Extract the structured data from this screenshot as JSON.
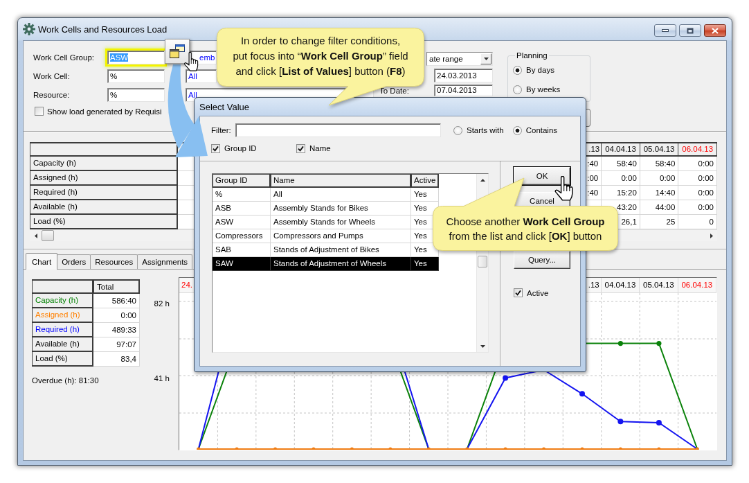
{
  "window": {
    "title": "Work Cells and Resources Load"
  },
  "filters": {
    "fields": [
      {
        "label": "Work Cell Group:",
        "value": "ASW",
        "focused": true,
        "description": "emb"
      },
      {
        "label": "Work Cell:",
        "value": "%",
        "focused": false,
        "description": "All"
      },
      {
        "label": "Resource:",
        "value": "%",
        "focused": false,
        "description": "All"
      }
    ],
    "show_requisitions": {
      "label": "Show load generated by Requisi",
      "checked": false
    },
    "period": {
      "value": "ate range"
    },
    "from_date": {
      "value": "24.03.2013"
    },
    "to_date": {
      "label": "To Date:",
      "value": "07.04.2013"
    },
    "planning": {
      "title": "Planning",
      "options": [
        {
          "label": "By days",
          "selected": true
        },
        {
          "label": "By weeks",
          "selected": false
        }
      ]
    }
  },
  "load_grid": {
    "row_headers": [
      "Capacity (h)",
      "Assigned (h)",
      "Required (h)",
      "Available (h)",
      "Load (%)"
    ],
    "columns": [
      {
        "header": ".13",
        "weekend": false,
        "values": [
          ":40",
          ":00",
          ":40"
        ]
      },
      {
        "header": "04.04.13",
        "weekend": false,
        "values": [
          "58:40",
          "0:00",
          "15:20",
          "43:20",
          "26,1"
        ]
      },
      {
        "header": "05.04.13",
        "weekend": false,
        "values": [
          "58:40",
          "0:00",
          "14:40",
          "44:00",
          "25"
        ]
      },
      {
        "header": "06.04.13",
        "weekend": true,
        "values": [
          "0:00",
          "0:00",
          "0:00",
          "0:00",
          "0"
        ]
      }
    ]
  },
  "tabs": [
    {
      "label": "Chart",
      "selected": true
    },
    {
      "label": "Orders",
      "selected": false
    },
    {
      "label": "Resources",
      "selected": false
    },
    {
      "label": "Assignments",
      "selected": false
    }
  ],
  "summary": {
    "column": "Total",
    "rows": [
      {
        "label": "Capacity (h)",
        "value": "586:40",
        "color": "#008000"
      },
      {
        "label": "Assigned (h)",
        "value": "0:00",
        "color": "#ff8000"
      },
      {
        "label": "Required (h)",
        "value": "489:33",
        "color": "#0000ff"
      },
      {
        "label": "Available (h)",
        "value": "97:07",
        "color": "#000000"
      },
      {
        "label": "Load (%)",
        "value": "83,4",
        "color": "#000000"
      }
    ]
  },
  "overdue": "Overdue (h): 81:30",
  "chart": {
    "y_labels": [
      "82 h",
      "41 h"
    ],
    "headers": [
      {
        "label": "24.",
        "weekend": true
      },
      {
        "label": ".13",
        "weekend": false
      },
      {
        "label": "04.04.13",
        "weekend": false
      },
      {
        "label": "05.04.13",
        "weekend": false
      },
      {
        "label": "06.04.13",
        "weekend": true
      }
    ]
  },
  "dialog": {
    "title": "Select Value",
    "filter": {
      "label": "Filter:"
    },
    "match_modes": [
      {
        "label": "Starts with",
        "selected": false
      },
      {
        "label": "Contains",
        "selected": true
      }
    ],
    "search_in": [
      {
        "label": "Group ID",
        "checked": true
      },
      {
        "label": "Name",
        "checked": true
      }
    ],
    "list": {
      "columns": [
        "Group ID",
        "Name",
        "Active"
      ],
      "rows": [
        {
          "cells": [
            "%",
            "All",
            "Yes"
          ],
          "selected": false
        },
        {
          "cells": [
            "ASB",
            "Assembly Stands for Bikes",
            "Yes"
          ],
          "selected": false
        },
        {
          "cells": [
            "ASW",
            "Assembly Stands for Wheels",
            "Yes"
          ],
          "selected": false
        },
        {
          "cells": [
            "Compressors",
            "Compressors and Pumps",
            "Yes"
          ],
          "selected": false
        },
        {
          "cells": [
            "SAB",
            "Stands of Adjustment of Bikes",
            "Yes"
          ],
          "selected": false
        },
        {
          "cells": [
            "SAW",
            "Stands of Adjustment of Wheels",
            "Yes"
          ],
          "selected": true
        }
      ]
    },
    "buttons": [
      {
        "label": "OK",
        "default": true
      },
      {
        "label": "Cancel",
        "default": false
      },
      {
        "label": "Query...",
        "default": false
      }
    ],
    "active": {
      "label": "Active",
      "checked": true
    }
  },
  "callouts": [
    {
      "text": "In order to change filter conditions,\nput focus into “**Work Cell Group**” field\nand click [**List of Values**] button (**F8**)"
    },
    {
      "text": "Choose another **Work Cell Group**\nfrom the list and click [**OK**] button"
    }
  ]
}
